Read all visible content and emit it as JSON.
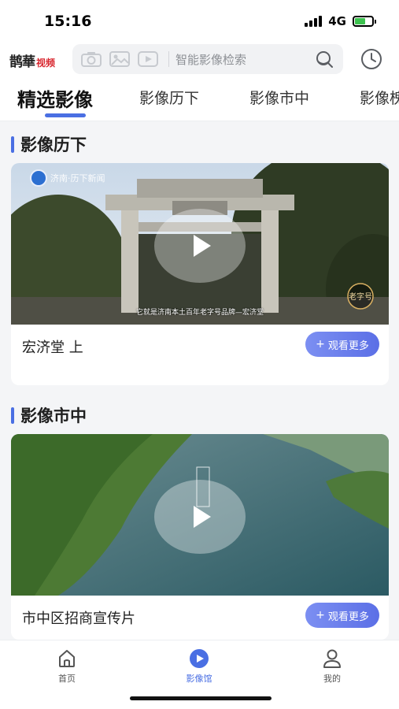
{
  "status": {
    "time": "15:16",
    "network": "4G",
    "battery_level": 0.6
  },
  "header": {
    "logo_main": "鹊華",
    "logo_sub": "视频",
    "search_placeholder": "智能影像检索",
    "icons": [
      "camera-icon",
      "image-icon",
      "video-icon",
      "search-icon",
      "history-icon"
    ]
  },
  "tabs": [
    {
      "label": "精选影像",
      "active": true
    },
    {
      "label": "影像历下",
      "active": false
    },
    {
      "label": "影像市中",
      "active": false
    },
    {
      "label": "影像槐荫",
      "active": false
    }
  ],
  "sections": [
    {
      "title": "影像历下",
      "video_title": "宏济堂 上",
      "more_label": "观看更多",
      "watermark": "济南·历下新闻",
      "subtitle": "它就是济南本土百年老字号品牌—宏济堂",
      "seal_text": "老字号"
    },
    {
      "title": "影像市中",
      "video_title": "市中区招商宣传片",
      "more_label": "观看更多"
    }
  ],
  "bottom_nav": [
    {
      "label": "首页",
      "icon": "home-icon",
      "active": false
    },
    {
      "label": "影像馆",
      "icon": "play-circle-icon",
      "active": true
    },
    {
      "label": "我的",
      "icon": "user-icon",
      "active": false
    }
  ],
  "colors": {
    "accent": "#4a6fe3",
    "more_button": "#6a7fec",
    "background": "#f4f5f7"
  }
}
